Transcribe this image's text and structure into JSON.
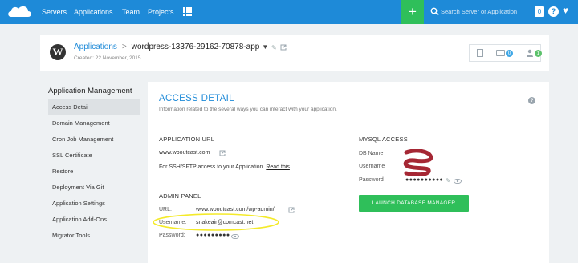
{
  "nav": {
    "items": [
      "Servers",
      "Applications",
      "Team",
      "Projects"
    ],
    "plus_label": "+",
    "search_placeholder": "Search Server or Application",
    "notif_count": "0",
    "help_label": "?"
  },
  "header": {
    "breadcrumb_root": "Applications",
    "separator": ">",
    "app_name": "wordpress-13376-29162-70878-app",
    "created": "Created: 22 November, 2015",
    "folder_count": "0",
    "user_count": "1"
  },
  "sidebar": {
    "title": "Application Management",
    "items": [
      "Access Detail",
      "Domain Management",
      "Cron Job Management",
      "SSL Certificate",
      "Restore",
      "Deployment Via Git",
      "Application Settings",
      "Application Add-Ons",
      "Migrator Tools"
    ]
  },
  "panel": {
    "title": "ACCESS DETAIL",
    "subtitle": "Information related to the several ways you can interact with your application.",
    "app_url": {
      "title": "APPLICATION URL",
      "url": "www.wpoutcast.com",
      "sftp_text": "For SSH/SFTP access to your Application.",
      "read_this": "Read this"
    },
    "admin": {
      "title": "ADMIN PANEL",
      "url_label": "URL:",
      "url_value": "www.wpoutcast.com/wp-admin/",
      "username_label": "Username:",
      "username_value": "snakeair@comcast.net",
      "password_label": "Password:",
      "password_dots": "●●●●●●●●●"
    },
    "mysql": {
      "title": "MYSQL ACCESS",
      "db_label": "DB Name",
      "user_label": "Username",
      "pass_label": "Password",
      "password_dots": "●●●●●●●●●●",
      "launch_label": "LAUNCH DATABASE MANAGER"
    }
  },
  "colors": {
    "topbar": "#1e8ad8",
    "accent_green": "#2fbf5a",
    "link_blue": "#1e8ad8",
    "highlight_marker": "#f4ea2a",
    "redaction": "#9b0f1e"
  }
}
